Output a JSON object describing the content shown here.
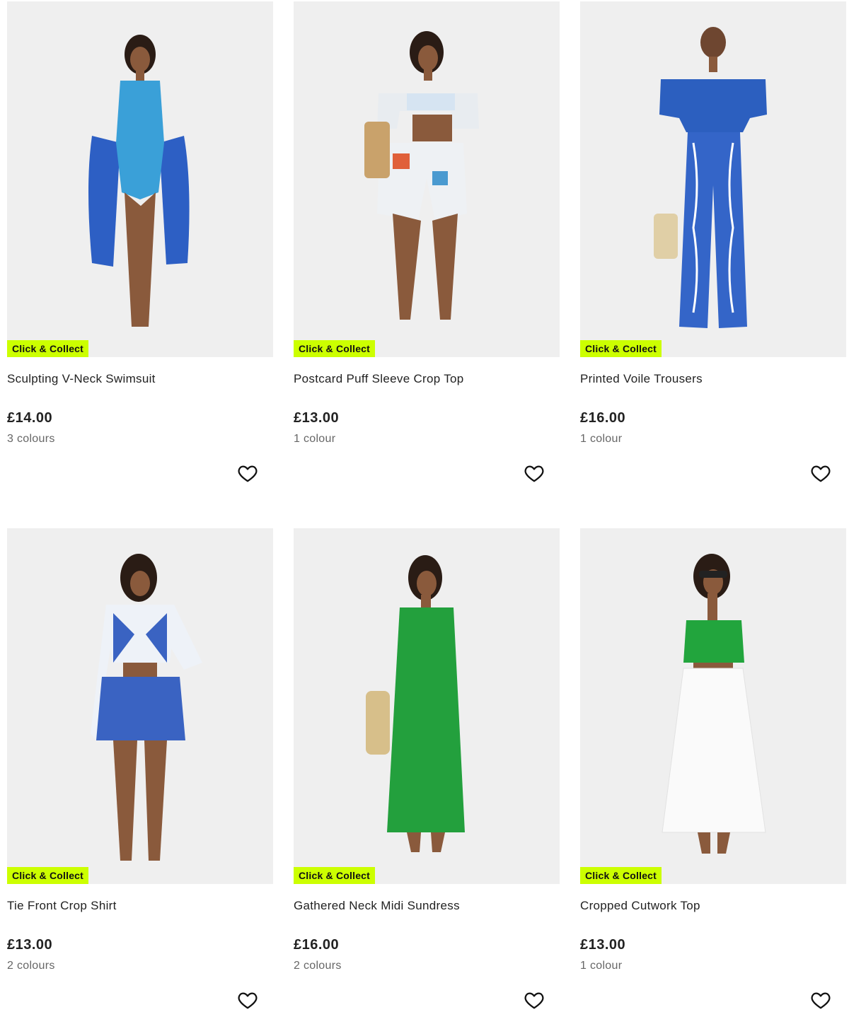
{
  "badge_color": "#ccff00",
  "products": [
    {
      "badge": "Click & Collect",
      "name": "Sculpting V-Neck Swimsuit",
      "price": "£14.00",
      "colours": "3 colours",
      "wish_icon": "heart-outline-icon"
    },
    {
      "badge": "Click & Collect",
      "name": "Postcard Puff Sleeve Crop Top",
      "price": "£13.00",
      "colours": "1 colour",
      "wish_icon": "heart-outline-icon"
    },
    {
      "badge": "Click & Collect",
      "name": "Printed Voile Trousers",
      "price": "£16.00",
      "colours": "1 colour",
      "wish_icon": "heart-outline-icon"
    },
    {
      "badge": "Click & Collect",
      "name": "Tie Front Crop Shirt",
      "price": "£13.00",
      "colours": "2 colours",
      "wish_icon": "heart-outline-icon"
    },
    {
      "badge": "Click & Collect",
      "name": "Gathered Neck Midi Sundress",
      "price": "£16.00",
      "colours": "2 colours",
      "wish_icon": "heart-outline-icon"
    },
    {
      "badge": "Click & Collect",
      "name": "Cropped Cutwork Top",
      "price": "£13.00",
      "colours": "1 colour",
      "wish_icon": "heart-outline-icon"
    }
  ]
}
